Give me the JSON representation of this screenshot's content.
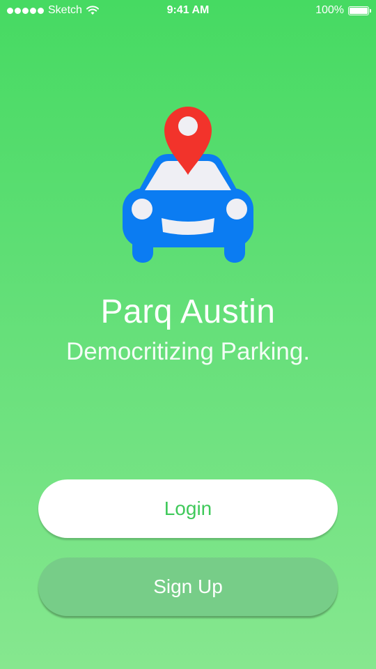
{
  "status_bar": {
    "carrier": "Sketch",
    "time": "9:41 AM",
    "battery": "100%"
  },
  "app": {
    "title": "Parq Austin",
    "tagline": "Democritizing Parking."
  },
  "buttons": {
    "login_label": "Login",
    "signup_label": "Sign Up"
  },
  "colors": {
    "background_top": "#46da62",
    "background_bottom": "#86e78f",
    "car_blue": "#0b7cf2",
    "pin_red": "#f2332b",
    "login_text": "#3fc95a",
    "signup_bg": "#77cd88"
  },
  "icons": {
    "signal": "signal-dots-icon",
    "wifi": "wifi-icon",
    "battery": "battery-icon",
    "logo": "car-with-location-pin-icon"
  }
}
